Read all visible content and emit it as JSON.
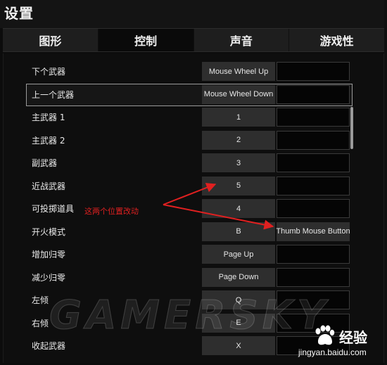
{
  "window": {
    "title": "设置"
  },
  "tabs": [
    {
      "label": "图形",
      "active": false
    },
    {
      "label": "控制",
      "active": true
    },
    {
      "label": "声音",
      "active": false
    },
    {
      "label": "游戏性",
      "active": false
    }
  ],
  "bindings": [
    {
      "action": "下个武器",
      "key1": "Mouse Wheel Up",
      "key2": ""
    },
    {
      "action": "上一个武器",
      "key1": "Mouse Wheel Down",
      "key2": ""
    },
    {
      "action": "主武器 1",
      "key1": "1",
      "key2": ""
    },
    {
      "action": "主武器 2",
      "key1": "2",
      "key2": ""
    },
    {
      "action": "副武器",
      "key1": "3",
      "key2": ""
    },
    {
      "action": "近战武器",
      "key1": "5",
      "key2": ""
    },
    {
      "action": "可投掷道具",
      "key1": "4",
      "key2": ""
    },
    {
      "action": "开火模式",
      "key1": "B",
      "key2": "Thumb Mouse Button"
    },
    {
      "action": "增加归零",
      "key1": "Page Up",
      "key2": ""
    },
    {
      "action": "减少归零",
      "key1": "Page Down",
      "key2": ""
    },
    {
      "action": "左倾",
      "key1": "Q",
      "key2": ""
    },
    {
      "action": "右倾",
      "key1": "E",
      "key2": ""
    },
    {
      "action": "收起武器",
      "key1": "X",
      "key2": ""
    }
  ],
  "annotation": {
    "text": "这两个位置改动",
    "color": "#e02020"
  },
  "watermarks": {
    "gamersky": "GAMERSKY",
    "baidu_cn": "经验",
    "baidu_url": "jingyan.baidu.com"
  },
  "colors": {
    "background": "#0e0e0e",
    "key_cell": "#2e2e2e",
    "annotation": "#e02020"
  }
}
